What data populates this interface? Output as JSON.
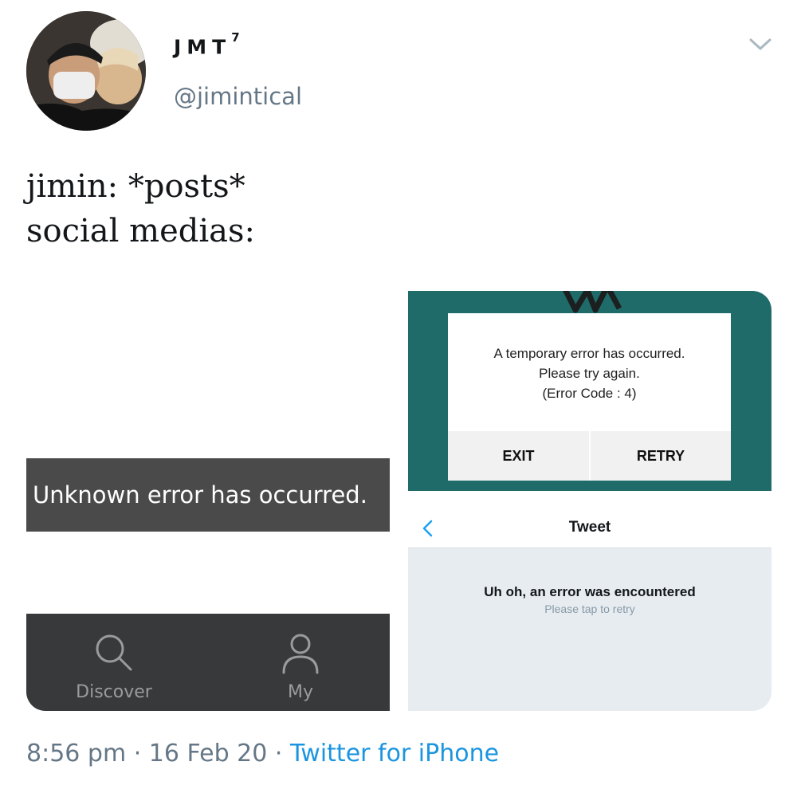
{
  "author": {
    "display_name": "JMT",
    "display_name_suffix": "7",
    "handle": "@jimintical"
  },
  "tweet": {
    "line1": "jimin: *posts*",
    "line2": "social medias:"
  },
  "media": {
    "panel1": {
      "error_text": "Unknown error has occurred.",
      "nav_discover": "Discover",
      "nav_my": "My"
    },
    "panel2": {
      "message_line1": "A temporary error has occurred.",
      "message_line2": "Please try again.",
      "message_line3": "(Error Code : 4)",
      "exit_label": "EXIT",
      "retry_label": "RETRY"
    },
    "panel3": {
      "header_title": "Tweet",
      "error_main": "Uh oh, an error was encountered",
      "error_sub": "Please tap to retry"
    }
  },
  "footer": {
    "time": "8:56 pm",
    "separator": " · ",
    "date": "16 Feb 20",
    "source": "Twitter for iPhone"
  },
  "colors": {
    "link": "#1b95e0",
    "muted": "#657786",
    "teal": "#1f6b6a"
  },
  "icons": [
    "chevron-down-icon",
    "search-icon",
    "user-icon",
    "back-chevron-icon"
  ]
}
